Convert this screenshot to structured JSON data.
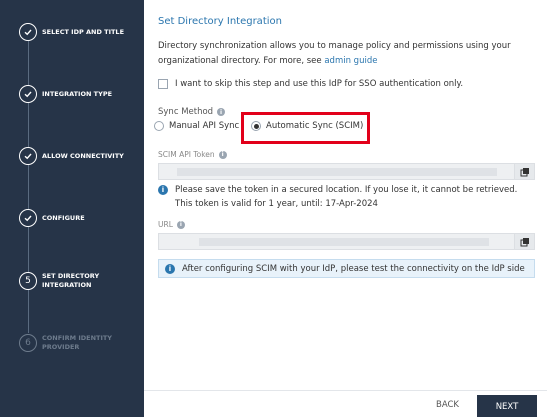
{
  "sidebar": {
    "steps": [
      {
        "label": "SELECT IDP AND TITLE",
        "state": "complete"
      },
      {
        "label": "INTEGRATION TYPE",
        "state": "complete"
      },
      {
        "label": "ALLOW CONNECTIVITY",
        "state": "complete"
      },
      {
        "label": "CONFIGURE",
        "state": "complete"
      },
      {
        "label": "SET DIRECTORY INTEGRATION",
        "number": "5",
        "state": "current"
      },
      {
        "label": "CONFIRM IDENTITY PROVIDER",
        "number": "6",
        "state": "disabled"
      }
    ]
  },
  "main": {
    "title": "Set Directory Integration",
    "description": "Directory synchronization allows you to manage policy and permissions using your organizational directory. For more, see ",
    "description_link": "admin guide",
    "skip_checkbox_label": "I want to skip this step and use this IdP for SSO authentication only.",
    "sync_method_label": "Sync Method",
    "sync_options": [
      "Manual API Sync",
      "Automatic Sync (SCIM)"
    ],
    "selected_sync": "Automatic Sync (SCIM)",
    "scim_token_label": "SCIM API Token",
    "token_note_line1": "Please save the token in a secured location. If you lose it, it cannot be retrieved.",
    "token_note_line2": "This token is valid for 1 year, until: 17-Apr-2024",
    "url_label": "URL",
    "info_message": "After configuring SCIM with your IdP, please test the connectivity on the IdP side"
  },
  "footer": {
    "back_label": "BACK",
    "next_label": "NEXT"
  },
  "colors": {
    "sidebar_bg": "#263448",
    "accent": "#2b76ae",
    "highlight": "#e2001a"
  }
}
